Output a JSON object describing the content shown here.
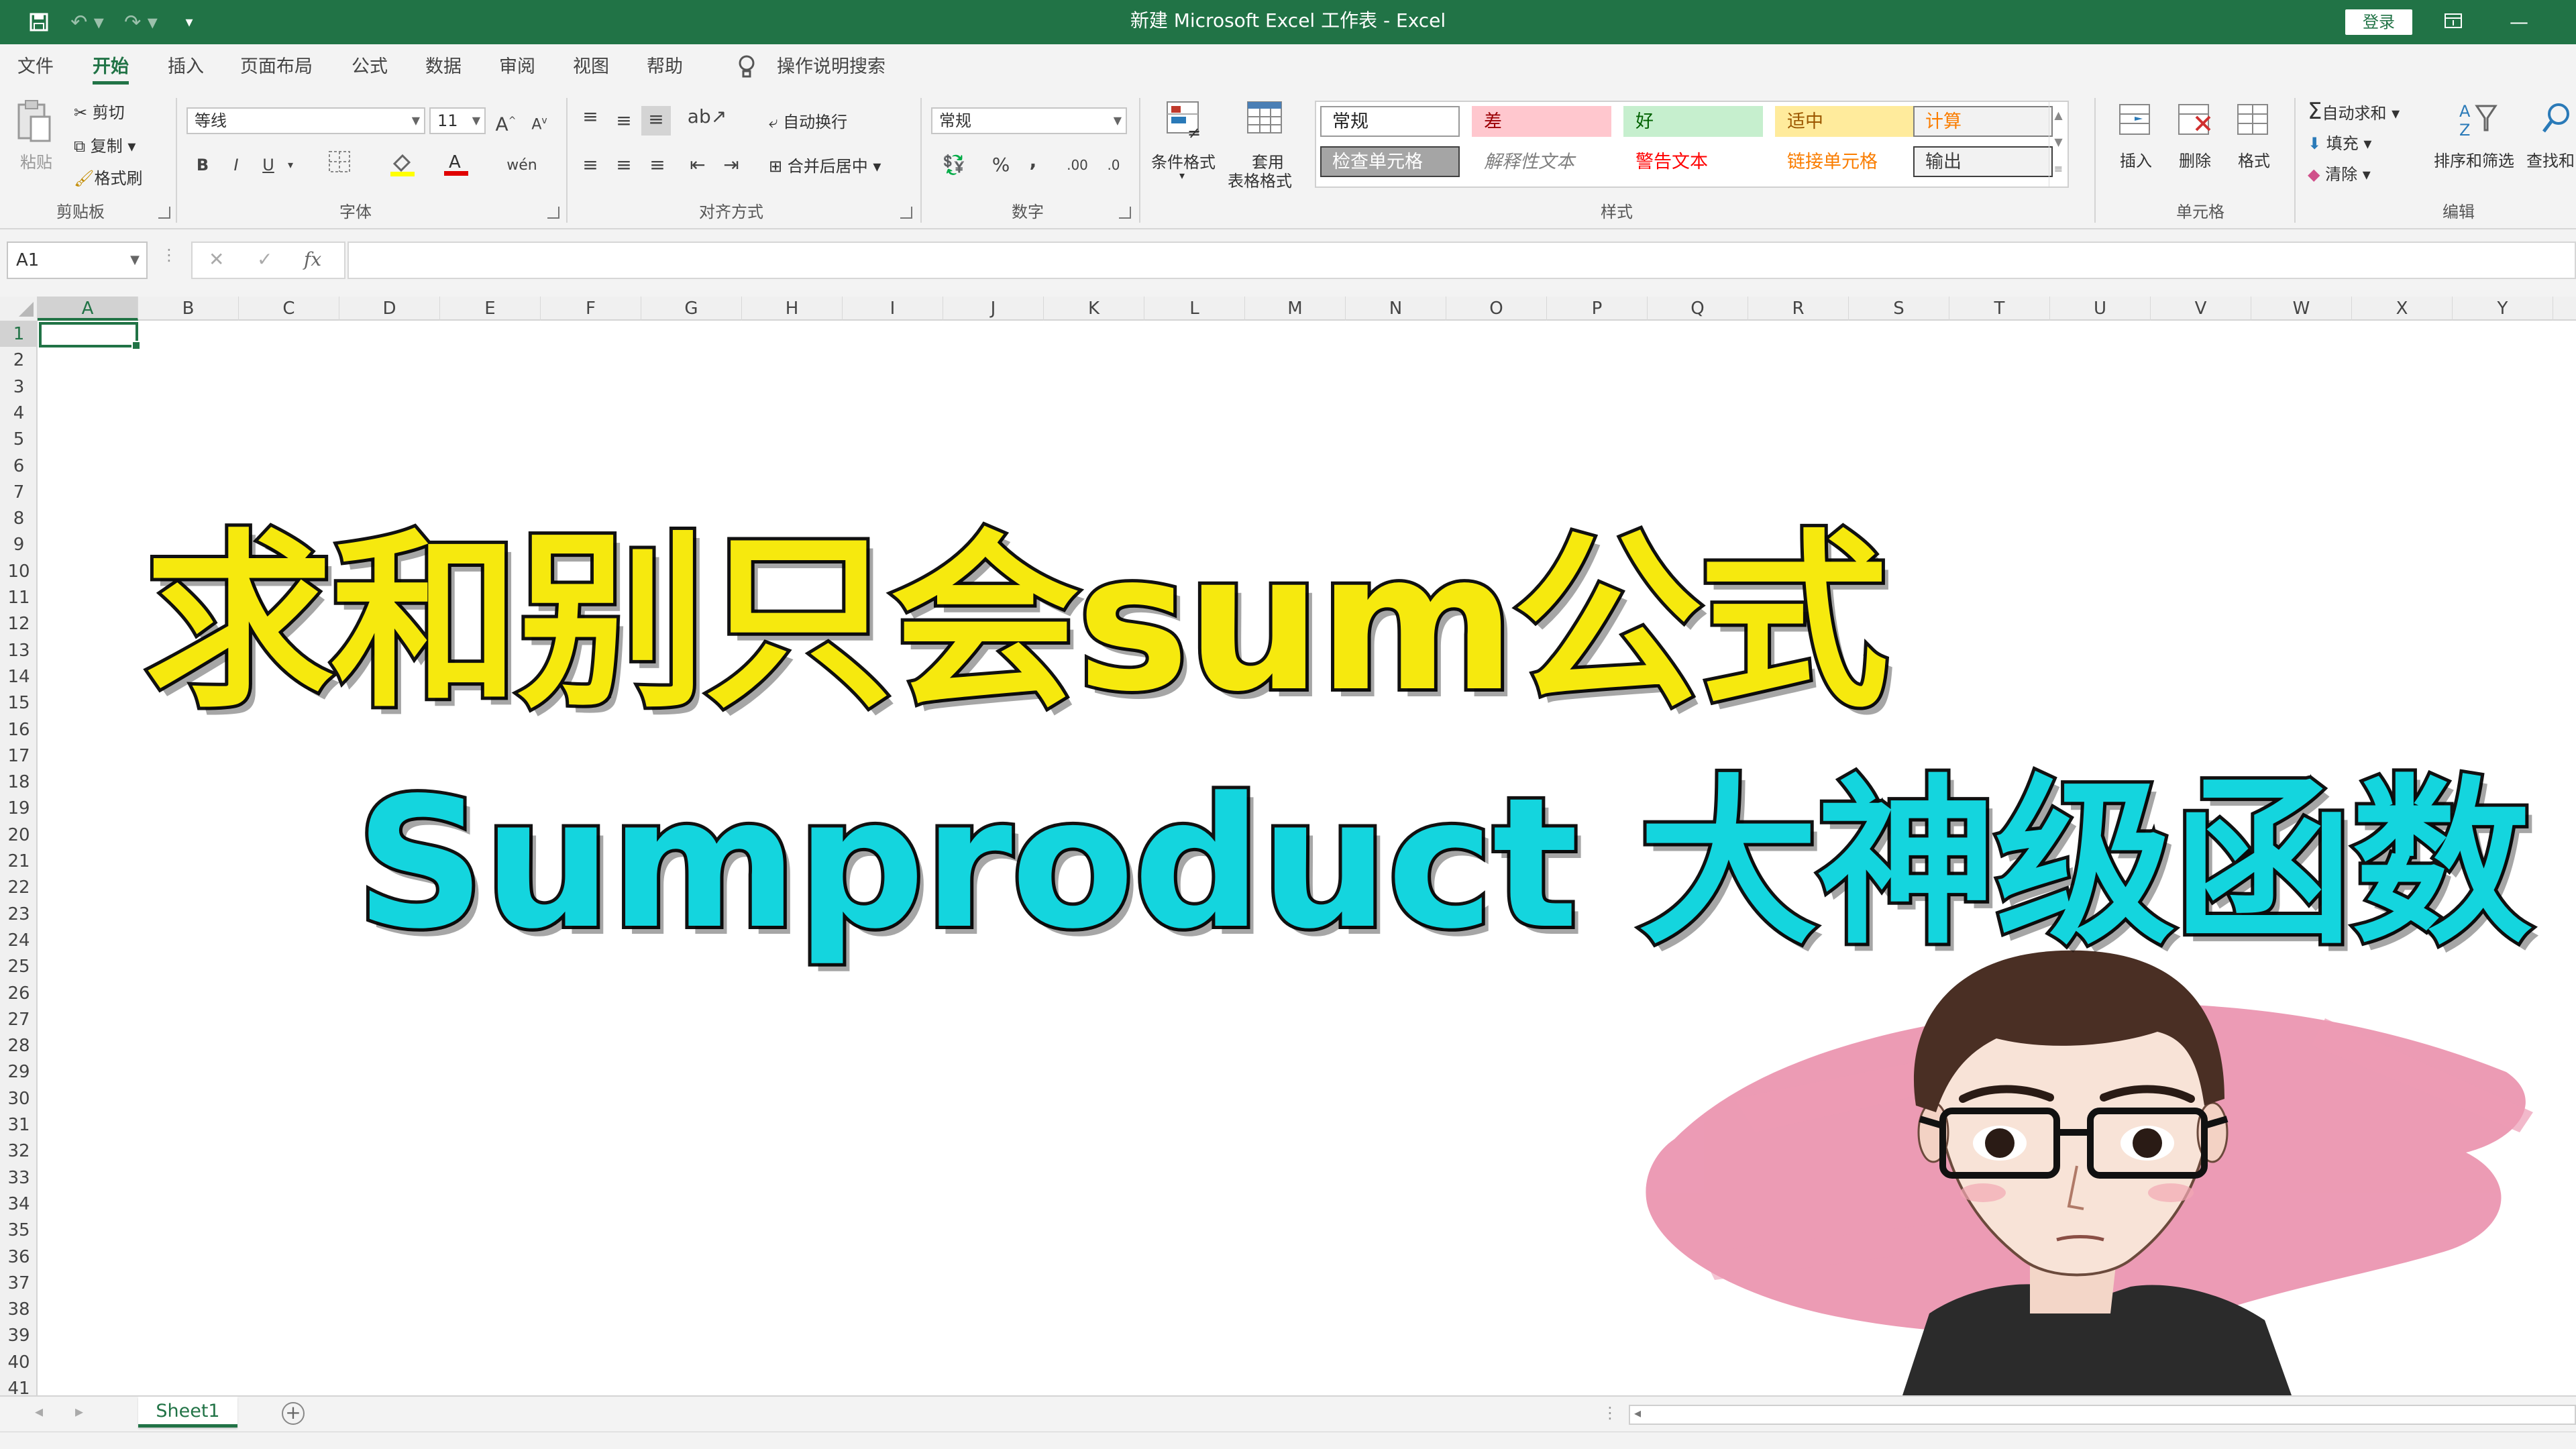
{
  "window": {
    "title": "新建 Microsoft Excel 工作表  -  Excel",
    "login_label": "登录",
    "quick_access": [
      "save-icon",
      "undo-icon",
      "redo-icon",
      "customize-icon"
    ]
  },
  "tabs": [
    "文件",
    "开始",
    "插入",
    "页面布局",
    "公式",
    "数据",
    "审阅",
    "视图",
    "帮助"
  ],
  "active_tab": "开始",
  "tell_me": "操作说明搜索",
  "ribbon": {
    "clipboard": {
      "paste": "粘贴",
      "cut": "剪切",
      "copy": "复制",
      "format_painter": "格式刷",
      "label": "剪贴板"
    },
    "font": {
      "name": "等线",
      "size": "11",
      "bold": "B",
      "italic": "I",
      "underline": "U",
      "grow": "A",
      "shrink": "A",
      "label": "字体"
    },
    "alignment": {
      "wrap": "自动换行",
      "merge": "合并后居中",
      "label": "对齐方式"
    },
    "number": {
      "format": "常规",
      "percent": "%",
      "comma": ",",
      "label": "数字"
    },
    "styles": {
      "conditional": "条件格式",
      "table_line1": "套用",
      "table_line2": "表格格式",
      "cells": [
        {
          "text": "常规",
          "bg": "#ffffff",
          "color": "#222222",
          "border": "#999999"
        },
        {
          "text": "差",
          "bg": "#ffc7ce",
          "color": "#9c0006",
          "border": "#ffc7ce"
        },
        {
          "text": "好",
          "bg": "#c6efce",
          "color": "#006100",
          "border": "#c6efce"
        },
        {
          "text": "适中",
          "bg": "#ffeb9c",
          "color": "#9c5700",
          "border": "#ffeb9c"
        },
        {
          "text": "计算",
          "bg": "#f2f2f2",
          "color": "#fa7d00",
          "border": "#7f7f7f"
        },
        {
          "text": "检查单元格",
          "bg": "#a5a5a5",
          "color": "#ffffff",
          "border": "#3f3f3f"
        },
        {
          "text": "解释性文本",
          "bg": "#ffffff",
          "color": "#7f7f7f",
          "border": "#ffffff"
        },
        {
          "text": "警告文本",
          "bg": "#ffffff",
          "color": "#ff0000",
          "border": "#ffffff"
        },
        {
          "text": "链接单元格",
          "bg": "#ffffff",
          "color": "#fa7d00",
          "border": "#ffffff"
        },
        {
          "text": "输出",
          "bg": "#f2f2f2",
          "color": "#3f3f3f",
          "border": "#3f3f3f"
        }
      ],
      "label": "样式"
    },
    "cells_group": {
      "insert": "插入",
      "delete": "删除",
      "format": "格式",
      "label": "单元格"
    },
    "editing": {
      "autosum": "自动求和",
      "fill": "填充",
      "clear": "清除",
      "sort": "排序和筛选",
      "find": "查找和",
      "label": "编辑"
    }
  },
  "name_box": "A1",
  "fx_label": "fx",
  "columns": [
    "A",
    "B",
    "C",
    "D",
    "E",
    "F",
    "G",
    "H",
    "I",
    "J",
    "K",
    "L",
    "M",
    "N",
    "O",
    "P",
    "Q",
    "R",
    "S",
    "T",
    "U",
    "V",
    "W",
    "X",
    "Y"
  ],
  "rows": [
    "1",
    "2",
    "3",
    "4",
    "5",
    "6",
    "7",
    "8",
    "9",
    "10",
    "11",
    "12",
    "13",
    "14",
    "15",
    "16",
    "17",
    "18",
    "19",
    "20",
    "21",
    "22",
    "23",
    "24",
    "25",
    "26",
    "27",
    "28",
    "29",
    "30",
    "31",
    "32",
    "33",
    "34",
    "35",
    "36",
    "37",
    "38",
    "39",
    "40",
    "41"
  ],
  "selected_cell": "A1",
  "overlay": {
    "line1": "求和别只会sum公式",
    "line2": "Sumproduct 大神级函数"
  },
  "sheet_tab": "Sheet1",
  "colors": {
    "excel_green": "#217346",
    "headline1": "#f6e90e",
    "headline2": "#14d5de",
    "splash": "#e98aa8"
  }
}
